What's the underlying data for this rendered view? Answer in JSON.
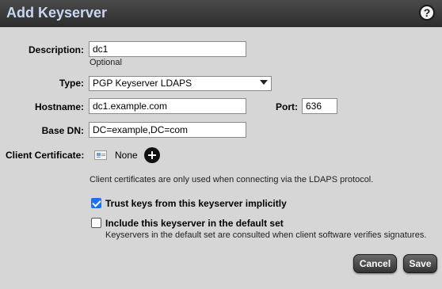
{
  "dialog": {
    "title": "Add Keyserver",
    "help_label": "?"
  },
  "form": {
    "description": {
      "label": "Description:",
      "value": "dc1",
      "hint": "Optional"
    },
    "type": {
      "label": "Type:",
      "value": "PGP Keyserver LDAPS"
    },
    "hostname": {
      "label": "Hostname:",
      "value": "dc1.example.com"
    },
    "port": {
      "label": "Port:",
      "value": "636"
    },
    "base_dn": {
      "label": "Base DN:",
      "value": "DC=example,DC=com"
    },
    "client_certificate": {
      "label": "Client Certificate:",
      "value": "None",
      "icon": "certificate-icon",
      "add_icon": "add-circle-icon",
      "note": "Client certificates are only used when connecting via the LDAPS protocol."
    },
    "trust_keys": {
      "label": "Trust keys from this keyserver implicitly",
      "checked": true
    },
    "default_set": {
      "label": "Include this keyserver in the default set",
      "checked": false,
      "note": "Keyservers in the default set are consulted when client software verifies signatures."
    }
  },
  "buttons": {
    "cancel": "Cancel",
    "save": "Save"
  },
  "colors": {
    "titlebar": "#3a3a3a",
    "title_text": "#c9d8f2",
    "checkbox_checked": "#1a73e8",
    "content_bg": "#d6d6d6"
  }
}
